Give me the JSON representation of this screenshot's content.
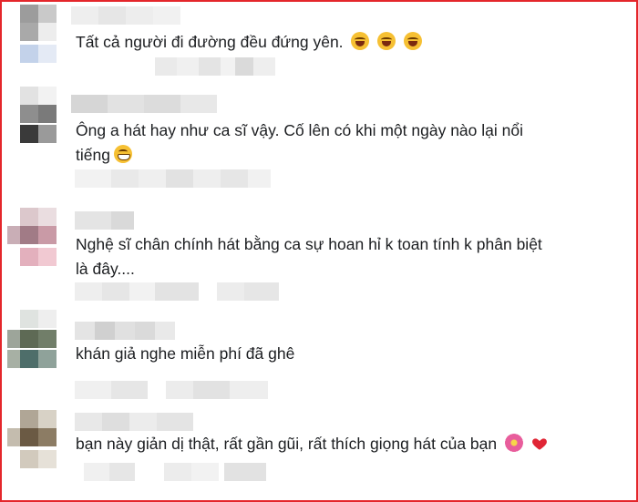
{
  "comments": [
    {
      "text_lines": [
        "Tất cả người đi đường đều đứng yên."
      ],
      "emojis": [
        "laughing-face",
        "laughing-face",
        "laughing-face"
      ]
    },
    {
      "text_lines": [
        "Ông a hát hay như ca sĩ vậy. Cố lên có khi một ngày nào lại nổi",
        "tiếng"
      ],
      "emojis": [
        "grinning-face"
      ]
    },
    {
      "text_lines": [
        "Nghệ sĩ chân chính hát bằng ca sự hoan hỉ k toan tính k phân biệt",
        "là đây...."
      ],
      "emojis": []
    },
    {
      "text_lines": [
        "khán giả nghe miễn phí đã ghê"
      ],
      "emojis": []
    },
    {
      "text_lines": [
        "bạn này giản dị thật, rất gần gũi, rất thích giọng hát của bạn"
      ],
      "emojis": [
        "flower",
        "red-heart"
      ]
    }
  ],
  "colors": {
    "frame_border": "#e4262b",
    "text": "#1c1e21",
    "heart": "#e02535"
  }
}
